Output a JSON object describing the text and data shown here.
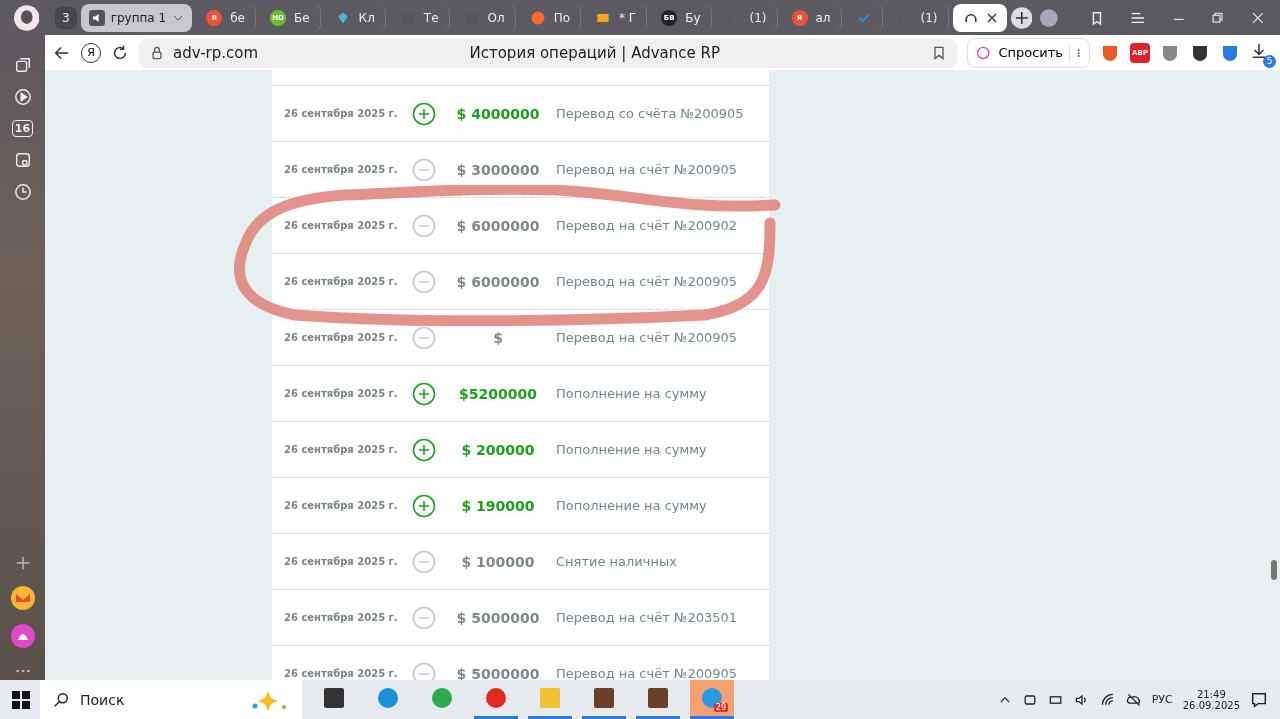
{
  "tab_bar": {
    "group_count": "3",
    "group": {
      "label": "группа 1",
      "expanded": false
    },
    "tabs": [
      {
        "kind": "letter",
        "logo": "Я",
        "color": "#f0503a",
        "label": "бе",
        "selected": false
      },
      {
        "kind": "letter",
        "logo": "HD",
        "color": "#6cbf2a",
        "label": "Бе",
        "selected": false
      },
      {
        "kind": "gem",
        "color": "#4fb0e0",
        "label": "Кл",
        "selected": false
      },
      {
        "kind": "camera",
        "color": "#555555",
        "label": "Те",
        "selected": false
      },
      {
        "kind": "camera",
        "color": "#555555",
        "label": "Ол",
        "selected": false
      },
      {
        "kind": "dots",
        "color": "#ff6a2a",
        "label": "По",
        "selected": false
      },
      {
        "kind": "mail",
        "color": "#f5a623",
        "label": "* Г",
        "selected": false
      },
      {
        "kind": "letter",
        "logo": "БВ",
        "color": "#222222",
        "label": "Бу",
        "selected": false
      },
      {
        "kind": "headset",
        "color": "#555555",
        "label": "(1)",
        "selected": false
      },
      {
        "kind": "letter",
        "logo": "Я",
        "color": "#f0503a",
        "label": "ал",
        "selected": false
      },
      {
        "kind": "check",
        "color": "#2a8ae0",
        "selected": false
      },
      {
        "kind": "headset",
        "color": "#555555",
        "label": "(1)",
        "selected": false
      },
      {
        "kind": "headset",
        "color": "#333333",
        "selected": true
      }
    ]
  },
  "toolbar": {
    "logo": "Я",
    "url": "adv-rp.com",
    "title": "История операций | Advance RP",
    "ask_button": "Спросить",
    "extensions": [
      {
        "kind": "shield",
        "color": "#ea5a2a"
      },
      {
        "kind": "abp",
        "label": "ABP",
        "color": "#e0202a"
      },
      {
        "kind": "shield",
        "color": "#888888"
      },
      {
        "kind": "puzzle",
        "color": "#333333"
      },
      {
        "kind": "doc",
        "color": "#2a7ae0"
      }
    ],
    "downloads_badge": "5"
  },
  "sidebar": {
    "calendar_day": "16"
  },
  "operations": [
    {
      "date": "26 сентября 2025 г.",
      "kind": "plus",
      "amount": "$ 4000000",
      "description": "Перевод со счёта №200905"
    },
    {
      "date": "26 сентября 2025 г.",
      "kind": "minus",
      "amount": "$ 3000000",
      "description": "Перевод на счёт №200905"
    },
    {
      "date": "26 сентября 2025 г.",
      "kind": "minus",
      "amount": "$ 6000000",
      "description": "Перевод на счёт №200902"
    },
    {
      "date": "26 сентября 2025 г.",
      "kind": "minus",
      "amount": "$ 6000000",
      "description": "Перевод на счёт №200905"
    },
    {
      "date": "26 сентября 2025 г.",
      "kind": "minus",
      "amount": "$",
      "description": "Перевод на счёт №200905"
    },
    {
      "date": "26 сентября 2025 г.",
      "kind": "plus",
      "amount": "$5200000",
      "description": "Пополнение на сумму"
    },
    {
      "date": "26 сентября 2025 г.",
      "kind": "plus",
      "amount": "$ 200000",
      "description": "Пополнение на сумму"
    },
    {
      "date": "26 сентября 2025 г.",
      "kind": "plus",
      "amount": "$ 190000",
      "description": "Пополнение на сумму"
    },
    {
      "date": "26 сентября 2025 г.",
      "kind": "minus",
      "amount": "$ 100000",
      "description": "Снятие наличных"
    },
    {
      "date": "26 сентября 2025 г.",
      "kind": "minus",
      "amount": "$ 5000000",
      "description": "Перевод на счёт №203501"
    },
    {
      "date": "26 сентября 2025 г.",
      "kind": "minus",
      "amount": "$ 5000000",
      "description": "Перевод на счёт №200905"
    }
  ],
  "taskbar": {
    "search_placeholder": "Поиск",
    "apps": [
      {
        "kind": "taskview",
        "active": false
      },
      {
        "kind": "edge",
        "active": false
      },
      {
        "kind": "whatsapp",
        "active": false
      },
      {
        "kind": "yandex",
        "active": true
      },
      {
        "kind": "folder",
        "active": true
      },
      {
        "kind": "photo",
        "active": true
      },
      {
        "kind": "photo",
        "active": true
      },
      {
        "kind": "telegram",
        "active": true,
        "badge": "29"
      }
    ],
    "language": "РУС",
    "time": "21:49",
    "date": "26.09.2025"
  }
}
